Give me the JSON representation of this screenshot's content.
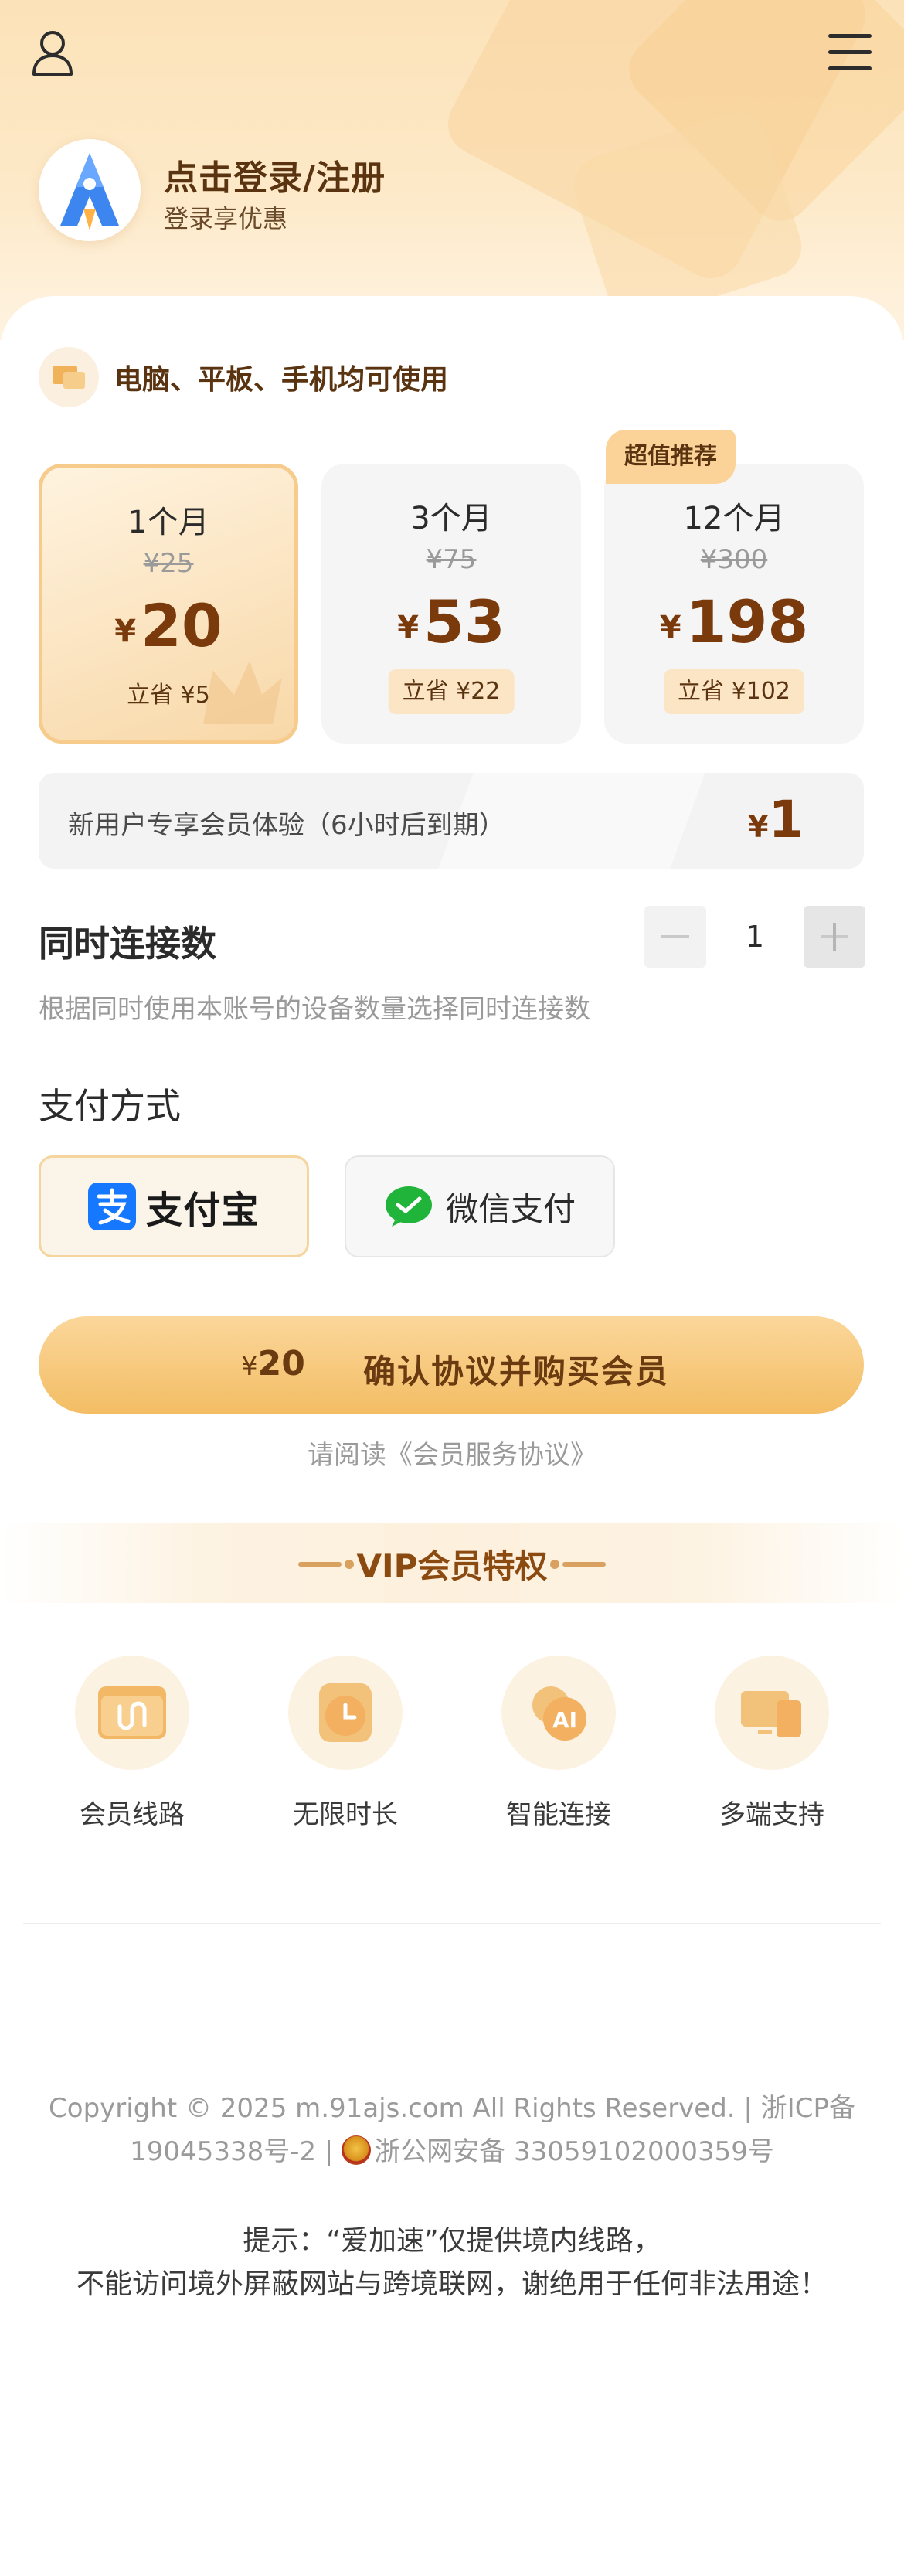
{
  "header": {
    "login_title": "点击登录/注册",
    "login_subtitle": "登录享优惠",
    "user_icon": "user-icon",
    "menu_icon": "menu-icon"
  },
  "devices": {
    "text": "电脑、平板、手机均可使用",
    "icon": "devices-icon"
  },
  "plans": [
    {
      "duration": "1个月",
      "original": "¥25",
      "currency": "¥",
      "price": "20",
      "saving": "立省 ¥5",
      "selected": true
    },
    {
      "duration": "3个月",
      "original": "¥75",
      "currency": "¥",
      "price": "53",
      "saving": "立省 ¥22",
      "selected": false
    },
    {
      "duration": "12个月",
      "original": "¥300",
      "currency": "¥",
      "price": "198",
      "saving": "立省 ¥102",
      "selected": false,
      "badge": "超值推荐"
    }
  ],
  "trial": {
    "text": "新用户专享会员体验（6小时后到期）",
    "currency": "¥",
    "price": "1"
  },
  "connections": {
    "title": "同时连接数",
    "value": "1",
    "description": "根据同时使用本账号的设备数量选择同时连接数"
  },
  "payment": {
    "title": "支付方式",
    "alipay_label": "支付宝",
    "wechat_label": "微信支付",
    "selected": "alipay"
  },
  "buy": {
    "currency": "¥",
    "price": "20",
    "label": "确认协议并购买会员"
  },
  "agreement": "请阅读《会员服务协议》",
  "vip": {
    "title": "VIP会员特权",
    "perks": [
      {
        "label": "会员线路",
        "icon": "vip-route-icon"
      },
      {
        "label": "无限时长",
        "icon": "clock-icon"
      },
      {
        "label": "智能连接",
        "icon": "ai-icon"
      },
      {
        "label": "多端支持",
        "icon": "multi-device-icon"
      }
    ]
  },
  "footer": {
    "copyright_line1": "Copyright © 2025 m.91ajs.com All Rights Reserved. | 浙ICP备",
    "copyright_line2_a": "19045338号-2 | ",
    "copyright_line2_b": "浙公网安备 33059102000359号",
    "notice_line1": "提示：“爱加速”仅提供境内线路，",
    "notice_line2": "不能访问境外屏蔽网站与跨境联网，谢绝用于任何非法用途！"
  },
  "colors": {
    "accent": "#f3bd64",
    "brand_text": "#7a3a0c",
    "alipay": "#1677ff",
    "wechat": "#21b43a"
  }
}
